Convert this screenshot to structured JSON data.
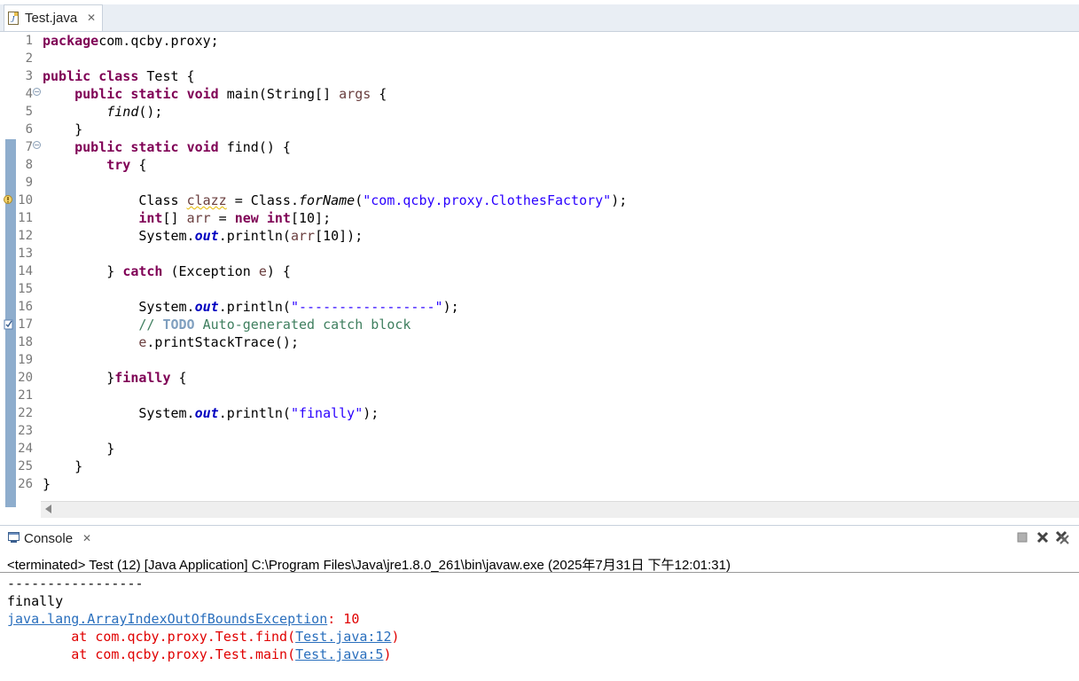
{
  "editor": {
    "tab": {
      "label": "Test.java",
      "icon": "java-file-icon",
      "close": "✕"
    },
    "lines": [
      {
        "n": "1",
        "tokens": [
          [
            "kw",
            "package"
          ],
          [
            "",
            "com.qcby.proxy;"
          ]
        ]
      },
      {
        "n": "2",
        "tokens": []
      },
      {
        "n": "3",
        "tokens": [
          [
            "kw",
            "public"
          ],
          [
            "",
            " "
          ],
          [
            "kw",
            "class"
          ],
          [
            "",
            " Test {"
          ]
        ]
      },
      {
        "n": "4",
        "fold": true,
        "tokens": [
          [
            "",
            "    "
          ],
          [
            "kw",
            "public"
          ],
          [
            "",
            " "
          ],
          [
            "kw",
            "static"
          ],
          [
            "",
            " "
          ],
          [
            "kw",
            "void"
          ],
          [
            "",
            " main(String[] "
          ],
          [
            "var",
            "args"
          ],
          [
            "",
            " {"
          ]
        ]
      },
      {
        "n": "5",
        "tokens": [
          [
            "",
            "        "
          ],
          [
            "italic",
            "find"
          ],
          [
            "",
            "();"
          ]
        ]
      },
      {
        "n": "6",
        "tokens": [
          [
            "",
            "    }"
          ]
        ]
      },
      {
        "n": "7",
        "fold": true,
        "tokens": [
          [
            "",
            "    "
          ],
          [
            "kw",
            "public"
          ],
          [
            "",
            " "
          ],
          [
            "kw",
            "static"
          ],
          [
            "",
            " "
          ],
          [
            "kw",
            "void"
          ],
          [
            "",
            " find() {"
          ]
        ]
      },
      {
        "n": "8",
        "tokens": [
          [
            "",
            "        "
          ],
          [
            "kw",
            "try"
          ],
          [
            "",
            " {"
          ]
        ]
      },
      {
        "n": "9",
        "tokens": []
      },
      {
        "n": "10",
        "mark": "warning",
        "tokens": [
          [
            "",
            "            Class "
          ],
          [
            "warn-underline var",
            "clazz"
          ],
          [
            "",
            " = Class."
          ],
          [
            "italic",
            "forName"
          ],
          [
            "",
            "("
          ],
          [
            "str",
            "\"com.qcby.proxy.ClothesFactory\""
          ],
          [
            "",
            ");"
          ]
        ]
      },
      {
        "n": "11",
        "tokens": [
          [
            "",
            "            "
          ],
          [
            "kw",
            "int"
          ],
          [
            "",
            "[] "
          ],
          [
            "var",
            "arr"
          ],
          [
            "",
            " = "
          ],
          [
            "kw",
            "new"
          ],
          [
            "",
            " "
          ],
          [
            "kw",
            "int"
          ],
          [
            "",
            "[10];"
          ]
        ]
      },
      {
        "n": "12",
        "tokens": [
          [
            "",
            "            System."
          ],
          [
            "static-f",
            "out"
          ],
          [
            "",
            ".println("
          ],
          [
            "var",
            "arr"
          ],
          [
            "",
            "[10]);"
          ]
        ]
      },
      {
        "n": "13",
        "tokens": []
      },
      {
        "n": "14",
        "tokens": [
          [
            "",
            "        } "
          ],
          [
            "kw",
            "catch"
          ],
          [
            "",
            " (Exception "
          ],
          [
            "var",
            "e"
          ],
          [
            "",
            ") {"
          ]
        ]
      },
      {
        "n": "15",
        "tokens": []
      },
      {
        "n": "16",
        "tokens": [
          [
            "",
            "            System."
          ],
          [
            "static-f",
            "out"
          ],
          [
            "",
            ".println("
          ],
          [
            "str",
            "\"-----------------\""
          ],
          [
            "",
            ");"
          ]
        ]
      },
      {
        "n": "17",
        "mark": "task",
        "tokens": [
          [
            "",
            "            "
          ],
          [
            "cmt",
            "// "
          ],
          [
            "todo",
            "TODO"
          ],
          [
            "cmt",
            " Auto-generated catch block"
          ]
        ]
      },
      {
        "n": "18",
        "tokens": [
          [
            "",
            "            "
          ],
          [
            "var",
            "e"
          ],
          [
            "",
            ".printStackTrace();"
          ]
        ]
      },
      {
        "n": "19",
        "tokens": []
      },
      {
        "n": "20",
        "tokens": [
          [
            "",
            "        }"
          ],
          [
            "kw",
            "finally"
          ],
          [
            "",
            " {"
          ]
        ]
      },
      {
        "n": "21",
        "tokens": []
      },
      {
        "n": "22",
        "tokens": [
          [
            "",
            "            System."
          ],
          [
            "static-f",
            "out"
          ],
          [
            "",
            ".println("
          ],
          [
            "str",
            "\"finally\""
          ],
          [
            "",
            ");"
          ]
        ]
      },
      {
        "n": "23",
        "tokens": []
      },
      {
        "n": "24",
        "tokens": [
          [
            "",
            "        }"
          ]
        ]
      },
      {
        "n": "25",
        "tokens": [
          [
            "",
            "    }"
          ]
        ]
      },
      {
        "n": "26",
        "tokens": [
          [
            "",
            "}"
          ]
        ]
      }
    ]
  },
  "console": {
    "tab": {
      "label": "Console",
      "icon": "console-icon",
      "close": "✕"
    },
    "toolbar": [
      "terminate-icon",
      "remove-launch-icon",
      "remove-all-launches-icon"
    ],
    "status": "<terminated> Test (12) [Java Application] C:\\Program Files\\Java\\jre1.8.0_261\\bin\\javaw.exe (2025年7月31日 下午12:01:31)",
    "output": {
      "line1": "-----------------",
      "line2": "finally",
      "exception_class": "java.lang.ArrayIndexOutOfBoundsException",
      "exception_msg": ": 10",
      "frame1_prefix": "        at com.qcby.proxy.Test.find(",
      "frame1_link": "Test.java:12",
      "frame1_suffix": ")",
      "frame2_prefix": "        at com.qcby.proxy.Test.main(",
      "frame2_link": "Test.java:5",
      "frame2_suffix": ")"
    }
  }
}
